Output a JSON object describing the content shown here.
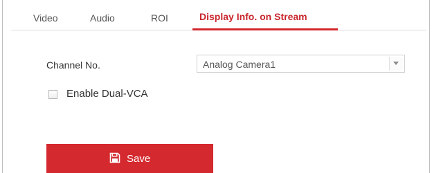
{
  "tabs": [
    {
      "label": "Video",
      "active": false
    },
    {
      "label": "Audio",
      "active": false
    },
    {
      "label": "ROI",
      "active": false
    },
    {
      "label": "Display Info. on Stream",
      "active": true
    }
  ],
  "form": {
    "channel_label": "Channel No.",
    "channel_value": "Analog Camera1",
    "dual_vca_label": "Enable Dual-VCA",
    "dual_vca_checked": false
  },
  "actions": {
    "save_label": "Save"
  },
  "colors": {
    "accent": "#d4252b",
    "button_bg": "#d4292e",
    "text": "#333333",
    "border": "#cfcfcf"
  },
  "icons": {
    "save": "floppy-disk-icon",
    "dropdown": "chevron-down-icon"
  }
}
